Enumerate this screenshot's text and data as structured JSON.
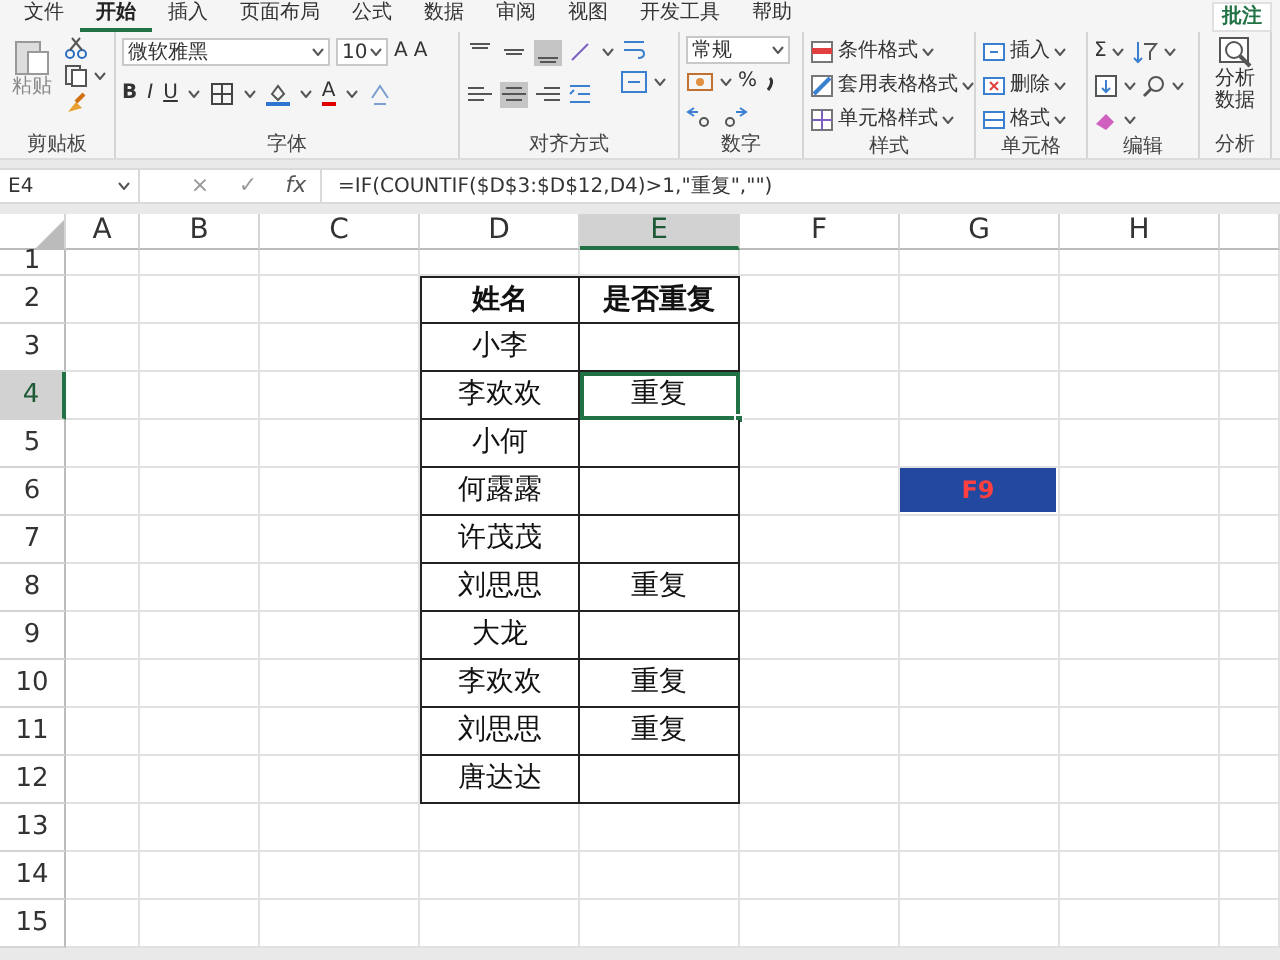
{
  "menu_tabs": [
    {
      "label": "文件",
      "selected": false
    },
    {
      "label": "开始",
      "selected": true
    },
    {
      "label": "插入",
      "selected": false
    },
    {
      "label": "页面布局",
      "selected": false
    },
    {
      "label": "公式",
      "selected": false
    },
    {
      "label": "数据",
      "selected": false
    },
    {
      "label": "审阅",
      "selected": false
    },
    {
      "label": "视图",
      "selected": false
    },
    {
      "label": "开发工具",
      "selected": false
    },
    {
      "label": "帮助",
      "selected": false
    }
  ],
  "comment_button": "批注",
  "ribbon": {
    "clipboard": {
      "paste": "粘贴",
      "label": "剪贴板"
    },
    "font": {
      "name": "微软雅黑",
      "size": "10",
      "grow": "A",
      "shrink": "A",
      "styles": [
        "B",
        "I",
        "U"
      ],
      "color_letter": "A",
      "label": "字体"
    },
    "alignment": {
      "vertical": [
        {
          "selected": false
        },
        {
          "selected": false
        },
        {
          "selected": true
        }
      ],
      "horizontal": [
        {
          "selected": false
        },
        {
          "selected": true
        },
        {
          "selected": false
        }
      ],
      "label": "对齐方式"
    },
    "number": {
      "format": "常规",
      "percent": "%",
      "label": "数字"
    },
    "styles": {
      "items": [
        "条件格式",
        "套用表格格式",
        "单元格样式"
      ],
      "label": "样式"
    },
    "cells": {
      "items": [
        "插入",
        "删除",
        "格式"
      ],
      "label": "单元格"
    },
    "editing": {
      "sum": "Σ",
      "label": "编辑"
    },
    "analysis": {
      "button": "分析数据",
      "label": "分析"
    }
  },
  "formula_bar": {
    "name_box": "E4",
    "cancel": "×",
    "enter": "✓",
    "fx": "fx",
    "formula": "=IF(COUNTIF($D$3:$D$12,D4)>1,\"重复\",\"\")"
  },
  "sheet": {
    "columns": [
      {
        "label": "A",
        "selected": false
      },
      {
        "label": "B",
        "selected": false
      },
      {
        "label": "C",
        "selected": false
      },
      {
        "label": "D",
        "selected": false
      },
      {
        "label": "E",
        "selected": true
      },
      {
        "label": "F",
        "selected": false
      },
      {
        "label": "G",
        "selected": false
      },
      {
        "label": "H",
        "selected": false
      }
    ],
    "rows": [
      {
        "label": "1",
        "selected": false
      },
      {
        "label": "2",
        "selected": false,
        "kind": "header",
        "cells": [
          {
            "text": "姓名",
            "selected": false
          },
          {
            "text": "是否重复",
            "selected": false
          }
        ]
      },
      {
        "label": "3",
        "selected": false,
        "kind": "data",
        "cells": [
          {
            "text": "小李",
            "selected": false
          },
          {
            "selected": false
          }
        ]
      },
      {
        "label": "4",
        "selected": true,
        "kind": "data",
        "cells": [
          {
            "text": "李欢欢",
            "selected": false
          },
          {
            "text": "重复",
            "selected": true
          }
        ]
      },
      {
        "label": "5",
        "selected": false,
        "kind": "data",
        "cells": [
          {
            "text": "小何",
            "selected": false
          },
          {
            "selected": false
          }
        ]
      },
      {
        "label": "6",
        "selected": false,
        "kind": "data",
        "cells": [
          {
            "text": "何露露",
            "selected": false
          },
          {
            "selected": false
          }
        ]
      },
      {
        "label": "7",
        "selected": false,
        "kind": "data",
        "cells": [
          {
            "text": "许茂茂",
            "selected": false
          },
          {
            "selected": false
          }
        ]
      },
      {
        "label": "8",
        "selected": false,
        "kind": "data",
        "cells": [
          {
            "text": "刘思思",
            "selected": false
          },
          {
            "text": "重复",
            "selected": false
          }
        ]
      },
      {
        "label": "9",
        "selected": false,
        "kind": "data",
        "cells": [
          {
            "text": "大龙",
            "selected": false
          },
          {
            "selected": false
          }
        ]
      },
      {
        "label": "10",
        "selected": false,
        "kind": "data",
        "cells": [
          {
            "text": "李欢欢",
            "selected": false
          },
          {
            "text": "重复",
            "selected": false
          }
        ]
      },
      {
        "label": "11",
        "selected": false,
        "kind": "data",
        "cells": [
          {
            "text": "刘思思",
            "selected": false
          },
          {
            "text": "重复",
            "selected": false
          }
        ]
      },
      {
        "label": "12",
        "selected": false,
        "kind": "data",
        "cells": [
          {
            "text": "唐达达",
            "selected": false
          },
          {
            "selected": false
          }
        ]
      },
      {
        "label": "13",
        "selected": false
      },
      {
        "label": "14",
        "selected": false
      },
      {
        "label": "15",
        "selected": false
      }
    ]
  },
  "key_hint": "F9"
}
